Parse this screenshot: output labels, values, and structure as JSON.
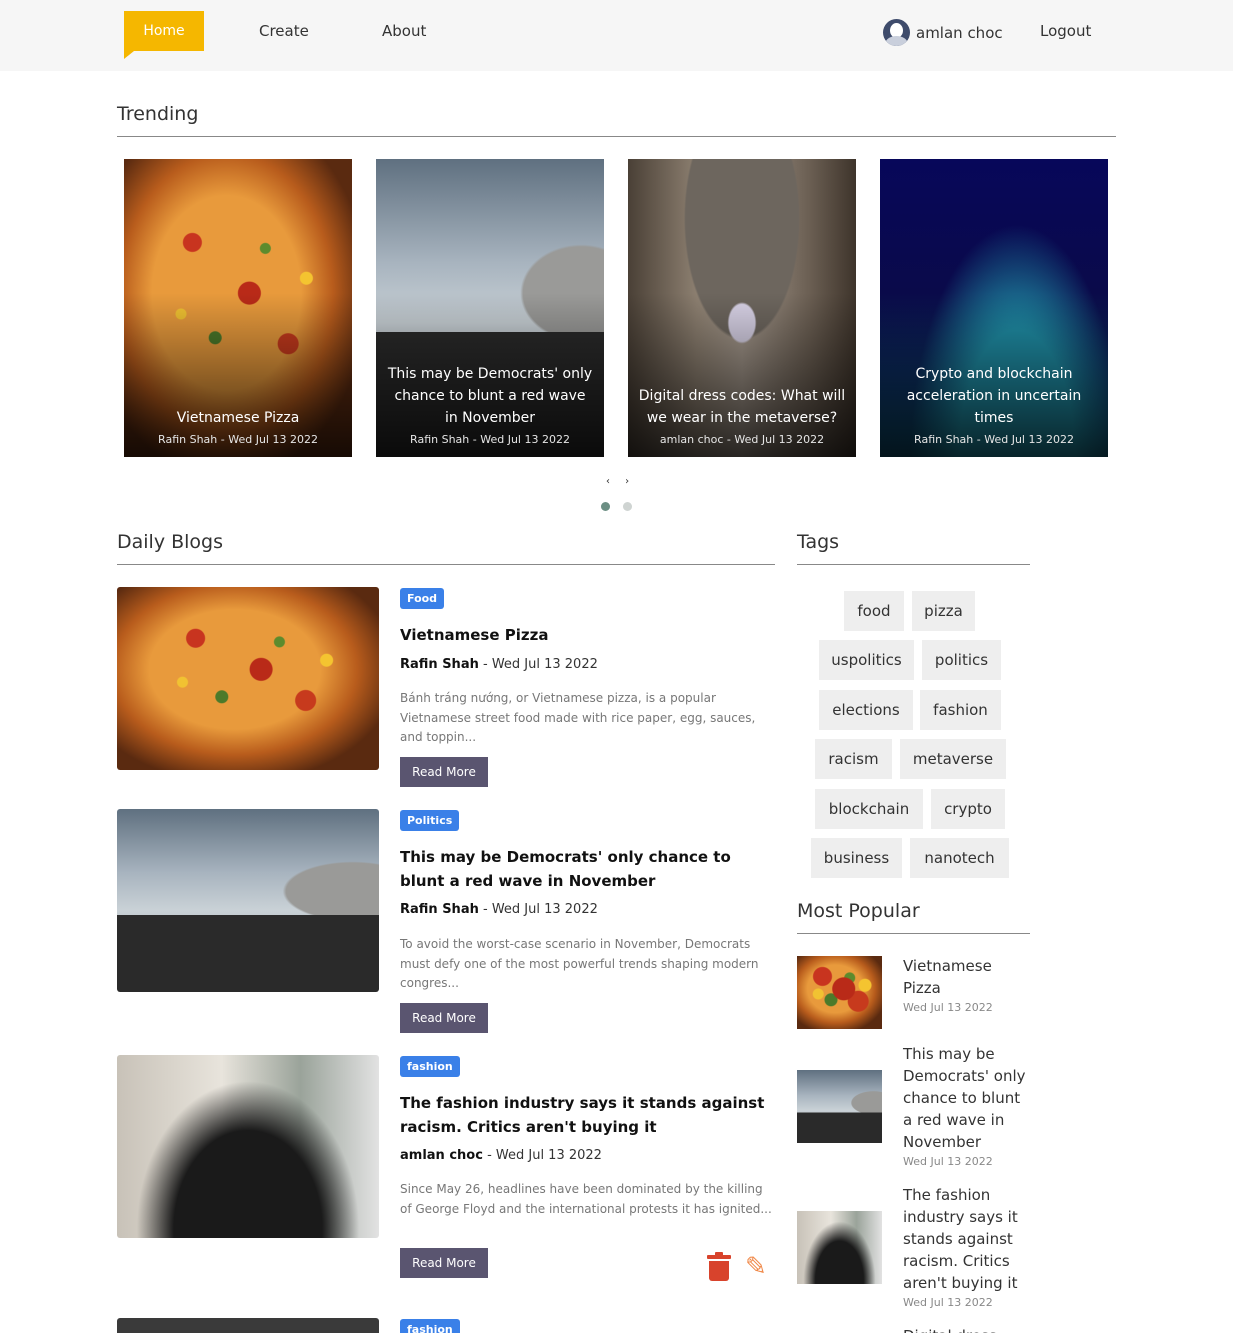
{
  "nav": {
    "home": "Home",
    "create": "Create",
    "about": "About",
    "user": "amlan choc",
    "logout": "Logout"
  },
  "trending": {
    "title": "Trending",
    "cards": [
      {
        "title": "Vietnamese Pizza",
        "meta": "Rafin Shah - Wed Jul 13 2022",
        "image": "pizza"
      },
      {
        "title": "This may be Democrats' only chance to blunt a red wave in November",
        "meta": "Rafin Shah - Wed Jul 13 2022",
        "image": "capitol"
      },
      {
        "title": "Digital dress codes: What will we wear in the metaverse?",
        "meta": "amlan choc - Wed Jul 13 2022",
        "image": "archway-fashion"
      },
      {
        "title": "Crypto and blockchain acceleration in uncertain times",
        "meta": "Rafin Shah - Wed Jul 13 2022",
        "image": "crypto-network"
      }
    ],
    "arrows": "‹ ›"
  },
  "daily": {
    "title": "Daily Blogs",
    "posts": [
      {
        "tag": "Food",
        "title": "Vietnamese Pizza",
        "author": "Rafin Shah",
        "date": " - Wed Jul 13 2022",
        "excerpt": "Bánh tráng nướng, or Vietnamese pizza, is a popular Vietnamese street food made with rice paper, egg, sauces, and toppin...",
        "button": "Read More"
      },
      {
        "tag": "Politics",
        "title": "This may be Democrats' only chance to blunt a red wave in November",
        "author": "Rafin Shah",
        "date": " - Wed Jul 13 2022",
        "excerpt": "To avoid the worst-case scenario in November, Democrats must defy one of the most powerful trends shaping modern congres...",
        "button": "Read More"
      },
      {
        "tag": "fashion",
        "title": "The fashion industry says it stands against racism. Critics aren't buying it",
        "author": "amlan choc",
        "date": " - Wed Jul 13 2022",
        "excerpt": "Since May 26, headlines have been dominated by the killing of George Floyd and the international protests it has ignited...",
        "button": "Read More"
      },
      {
        "tag": "fashion"
      }
    ]
  },
  "tags": {
    "title": "Tags",
    "items": [
      "food",
      "pizza",
      "uspolitics",
      "politics",
      "elections",
      "fashion",
      "racism",
      "metaverse",
      "blockchain",
      "crypto",
      "business",
      "nanotech"
    ]
  },
  "popular": {
    "title": "Most Popular",
    "items": [
      {
        "title": "Vietnamese Pizza",
        "date": "Wed Jul 13 2022"
      },
      {
        "title": "This may be Democrats' only chance to blunt a red wave in November",
        "date": "Wed Jul 13 2022"
      },
      {
        "title": "The fashion industry says it stands against racism. Critics aren't buying it",
        "date": "Wed Jul 13 2022"
      },
      {
        "title": "Digital dress"
      }
    ]
  },
  "icons": {
    "delete": "trash-icon",
    "edit": "edit-icon",
    "user": "user-avatar-icon"
  },
  "colors": {
    "accent": "#f5b700",
    "badge": "#3a80e8",
    "button": "#5a5570",
    "delete": "#d8432c",
    "edit": "#f08a4b"
  }
}
